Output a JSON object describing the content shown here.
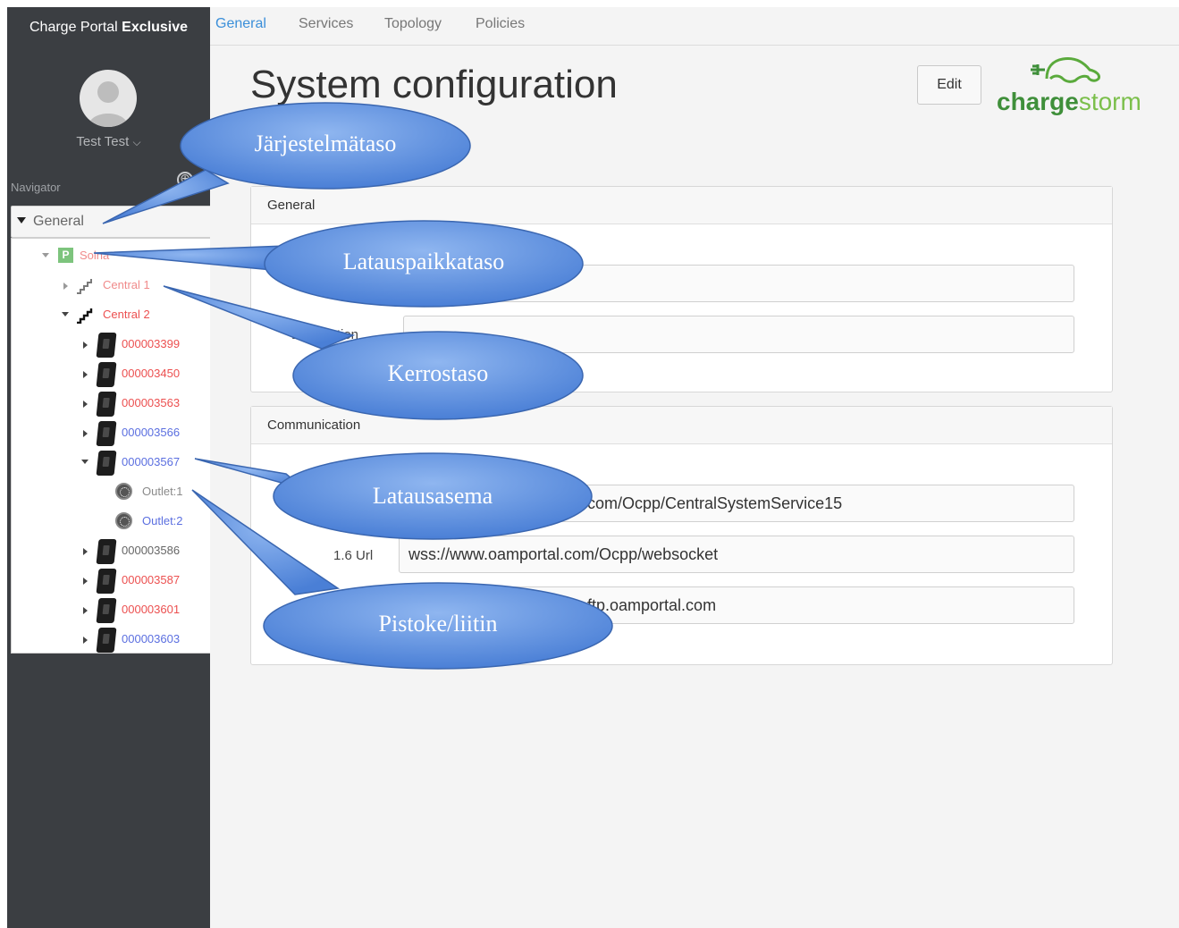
{
  "sidebar": {
    "brand_plain": "Charge Portal",
    "brand_bold": "Exclusive",
    "user_name": "Test Test",
    "user_caret": "⌵",
    "navigator_label": "Navigator",
    "add_icon": "⊕",
    "dropdown_value": "General",
    "tree": {
      "site": "Solna",
      "site_icon": "P",
      "floor1": "Central 1",
      "floor2": "Central 2",
      "stations": [
        "000003399",
        "000003450",
        "000003563",
        "000003566",
        "000003567"
      ],
      "outlets": [
        "Outlet:1",
        "Outlet:2"
      ],
      "stations_after": [
        "000003586",
        "000003587",
        "000003601",
        "000003603"
      ]
    }
  },
  "tabs": [
    "General",
    "Services",
    "Topology",
    "Policies"
  ],
  "header": {
    "title": "System configuration",
    "edit_label": "Edit",
    "logo_bold": "charge",
    "logo_rest": "storm"
  },
  "general_panel": {
    "title": "General",
    "description_label": "Description"
  },
  "communication_panel": {
    "title": "Communication",
    "url1_value": "com/Ocpp/CentralSystemService15",
    "url2_label": "1.6 Url",
    "url2_value": "wss://www.oamportal.com/Ocpp/websocket",
    "url3_value": "ftp.oamportal.com"
  },
  "callouts": {
    "system_level": "Järjestelmätaso",
    "site_level": "Latauspaikkataso",
    "floor_level": "Kerrostaso",
    "station": "Latausasema",
    "outlet": "Pistoke/liitin"
  },
  "colors": {
    "sidebar_bg": "#3b3e42",
    "active_tab": "#3b8fd9",
    "callout_fill": "#5d8fe0",
    "status_red": "#ec5050",
    "status_blue": "#5b6fe0"
  }
}
